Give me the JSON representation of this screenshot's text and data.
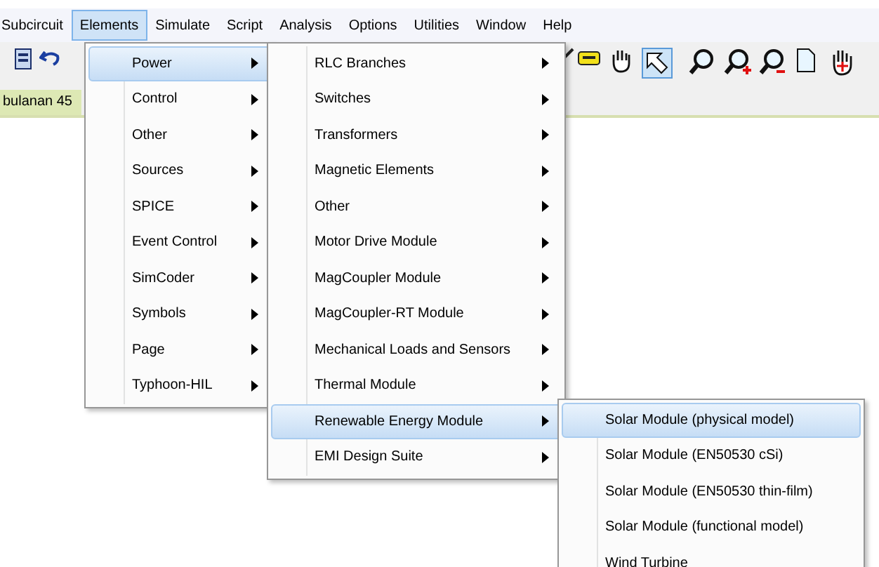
{
  "menubar": [
    {
      "label": "Subcircuit",
      "selected": false
    },
    {
      "label": "Elements",
      "selected": true
    },
    {
      "label": "Simulate",
      "selected": false
    },
    {
      "label": "Script",
      "selected": false
    },
    {
      "label": "Analysis",
      "selected": false
    },
    {
      "label": "Options",
      "selected": false
    },
    {
      "label": "Utilities",
      "selected": false
    },
    {
      "label": "Window",
      "selected": false
    },
    {
      "label": "Help",
      "selected": false
    }
  ],
  "document_tab": {
    "label": "bulanan 45"
  },
  "menus": [
    {
      "items": [
        {
          "label": "Power",
          "selected": true,
          "submenu": true
        },
        {
          "label": "Control",
          "selected": false,
          "submenu": true
        },
        {
          "label": "Other",
          "selected": false,
          "submenu": true
        },
        {
          "label": "Sources",
          "selected": false,
          "submenu": true
        },
        {
          "label": "SPICE",
          "selected": false,
          "submenu": true
        },
        {
          "label": "Event Control",
          "selected": false,
          "submenu": true
        },
        {
          "label": "SimCoder",
          "selected": false,
          "submenu": true
        },
        {
          "label": "Symbols",
          "selected": false,
          "submenu": true
        },
        {
          "label": "Page",
          "selected": false,
          "submenu": true
        },
        {
          "label": "Typhoon-HIL",
          "selected": false,
          "submenu": true
        }
      ]
    },
    {
      "items": [
        {
          "label": "RLC Branches",
          "selected": false,
          "submenu": true
        },
        {
          "label": "Switches",
          "selected": false,
          "submenu": true
        },
        {
          "label": "Transformers",
          "selected": false,
          "submenu": true
        },
        {
          "label": "Magnetic Elements",
          "selected": false,
          "submenu": true
        },
        {
          "label": "Other",
          "selected": false,
          "submenu": true
        },
        {
          "label": "Motor Drive Module",
          "selected": false,
          "submenu": true
        },
        {
          "label": "MagCoupler Module",
          "selected": false,
          "submenu": true
        },
        {
          "label": "MagCoupler-RT Module",
          "selected": false,
          "submenu": true
        },
        {
          "label": "Mechanical Loads and Sensors",
          "selected": false,
          "submenu": true
        },
        {
          "label": "Thermal Module",
          "selected": false,
          "submenu": true
        },
        {
          "label": "Renewable Energy Module",
          "selected": true,
          "submenu": true
        },
        {
          "label": "EMI Design Suite",
          "selected": false,
          "submenu": true
        }
      ]
    },
    {
      "items": [
        {
          "label": "Solar Module (physical model)",
          "selected": true,
          "submenu": false
        },
        {
          "label": "Solar Module (EN50530 cSi)",
          "selected": false,
          "submenu": false
        },
        {
          "label": "Solar Module (EN50530 thin-film)",
          "selected": false,
          "submenu": false
        },
        {
          "label": "Solar Module (functional model)",
          "selected": false,
          "submenu": false
        },
        {
          "label": "Wind Turbine",
          "selected": false,
          "submenu": false
        }
      ]
    }
  ]
}
